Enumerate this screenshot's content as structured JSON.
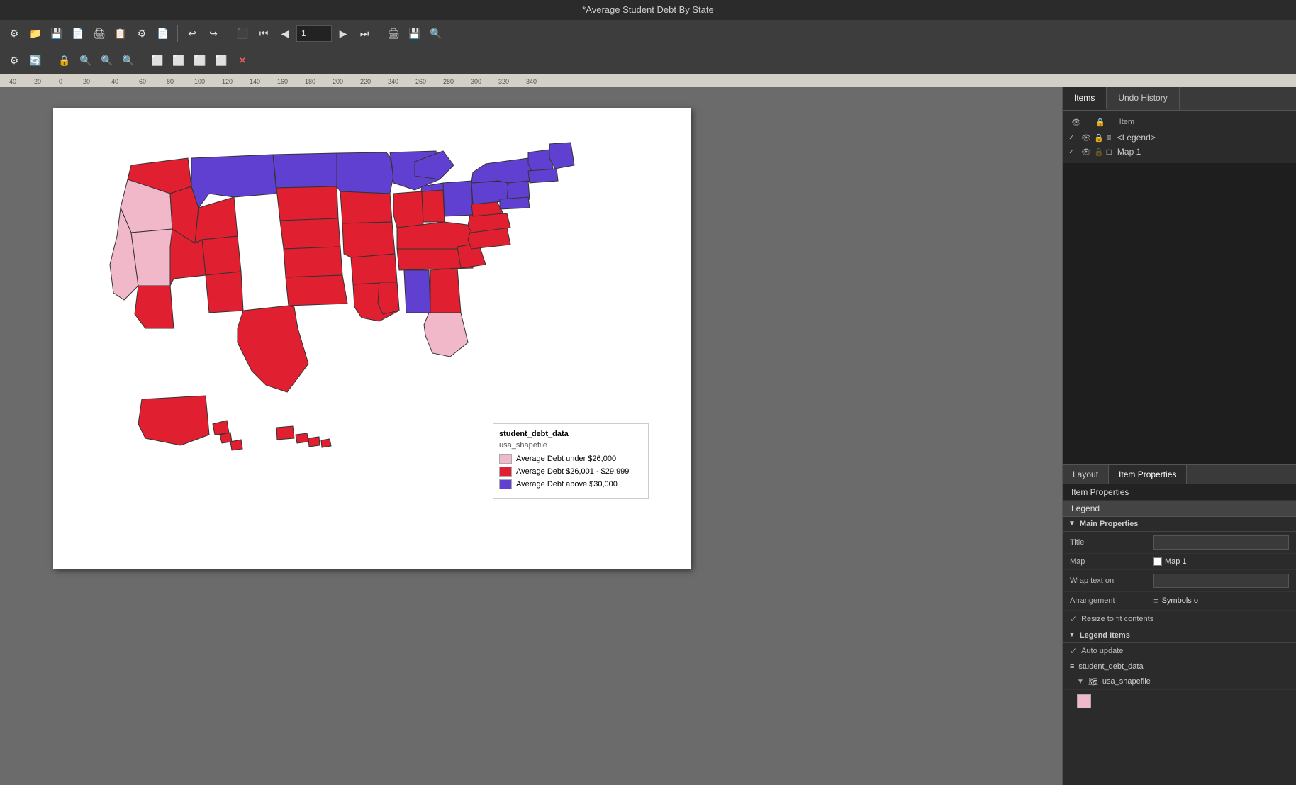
{
  "titleBar": {
    "title": "*Average Student Debt By State"
  },
  "toolbar1": {
    "buttons": [
      "✏️",
      "📂",
      "💾",
      "📄",
      "🖨️",
      "📋",
      "⚙️",
      "📄",
      "↩️",
      "↪️",
      "▪",
      "⏮",
      "◀",
      "1",
      "▶",
      "⏭",
      "🖨️",
      "💾",
      "🔍"
    ]
  },
  "toolbar2": {
    "buttons": [
      "⚙️",
      "🔄",
      "▪",
      "🔒",
      "🔍",
      "🔍",
      "🔍",
      "▪",
      "⬜",
      "⬜",
      "⬜",
      "⬜",
      "❌"
    ]
  },
  "panelTabs": {
    "items": "Items",
    "undoHistory": "Undo History"
  },
  "itemsPanel": {
    "columns": {
      "eye": "👁",
      "lock": "🔒",
      "item": "Item"
    },
    "rows": [
      {
        "checked": true,
        "eye": true,
        "lock": true,
        "icon": "≡",
        "label": "<Legend>",
        "type": "list"
      },
      {
        "checked": true,
        "eye": true,
        "lock": false,
        "icon": "□",
        "label": "Map 1",
        "type": "map"
      }
    ]
  },
  "secondaryTabs": {
    "layout": "Layout",
    "itemProperties": "Item Properties"
  },
  "itemProperties": {
    "label": "Item Properties",
    "selectedItem": "Legend",
    "mainProperties": {
      "sectionLabel": "Main Properties",
      "title": {
        "label": "Title",
        "value": ""
      },
      "map": {
        "label": "Map",
        "value": "Map 1"
      },
      "wrapText": {
        "label": "Wrap text on",
        "value": ""
      },
      "arrangement": {
        "label": "Arrangement",
        "value": "Symbols o"
      },
      "resizeToFit": {
        "label": "Resize to fit contents",
        "checked": true
      }
    },
    "legendItems": {
      "sectionLabel": "Legend Items",
      "autoUpdate": {
        "label": "Auto update",
        "checked": true
      },
      "layers": [
        {
          "label": "student_debt_data",
          "indent": false,
          "icon": "≡"
        },
        {
          "label": "usa_shapefile",
          "indent": true,
          "icon": "🏔️"
        }
      ]
    }
  },
  "legend": {
    "dataSource": "student_debt_data",
    "shapefile": "usa_shapefile",
    "items": [
      {
        "color": "#f4b8c8",
        "label": "Average Debt under $26,000"
      },
      {
        "color": "#e8303a",
        "label": "Average Debt $26,001 - $29,999"
      },
      {
        "color": "#6650e8",
        "label": "Average Debt above $30,000"
      }
    ]
  },
  "rulers": {
    "marks": [
      "-40",
      "-20",
      "0",
      "20",
      "40",
      "60",
      "80",
      "100",
      "120",
      "140",
      "160",
      "180",
      "200",
      "220",
      "240",
      "260",
      "280",
      "300",
      "320",
      "340"
    ]
  },
  "mapColors": {
    "lightPink": "#f0b8c8",
    "red": "#e02030",
    "purple": "#6040d0"
  }
}
